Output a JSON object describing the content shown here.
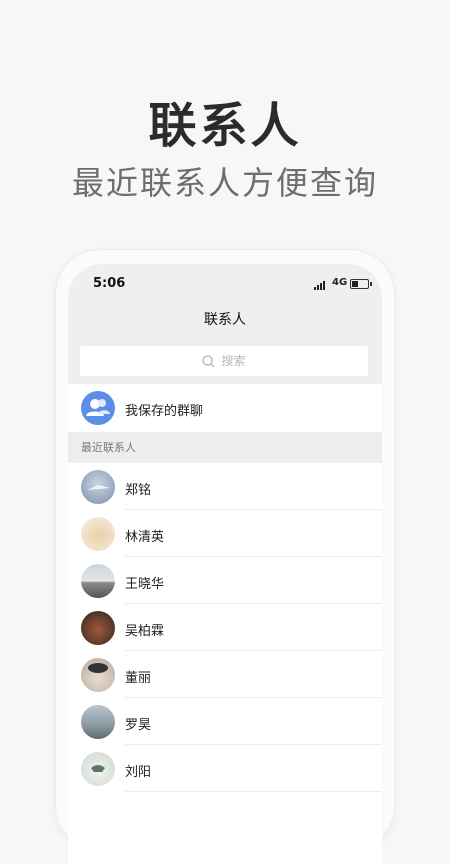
{
  "promo": {
    "title": "联系人",
    "subtitle": "最近联系人方便查询"
  },
  "status_bar": {
    "time": "5:06",
    "network": "4G",
    "battery_level": 0.4
  },
  "nav": {
    "title": "联系人"
  },
  "search": {
    "placeholder": "搜索",
    "icon": "search-icon"
  },
  "group_chats": {
    "label": "我保存的群聊",
    "icon": "group-chat-icon",
    "color": "#5b8ee6"
  },
  "section": {
    "title": "最近联系人"
  },
  "contacts": [
    {
      "name": "郑铭"
    },
    {
      "name": "林清英"
    },
    {
      "name": "王晓华"
    },
    {
      "name": "吴柏霖"
    },
    {
      "name": "董丽"
    },
    {
      "name": "罗昊"
    },
    {
      "name": "刘阳"
    }
  ]
}
